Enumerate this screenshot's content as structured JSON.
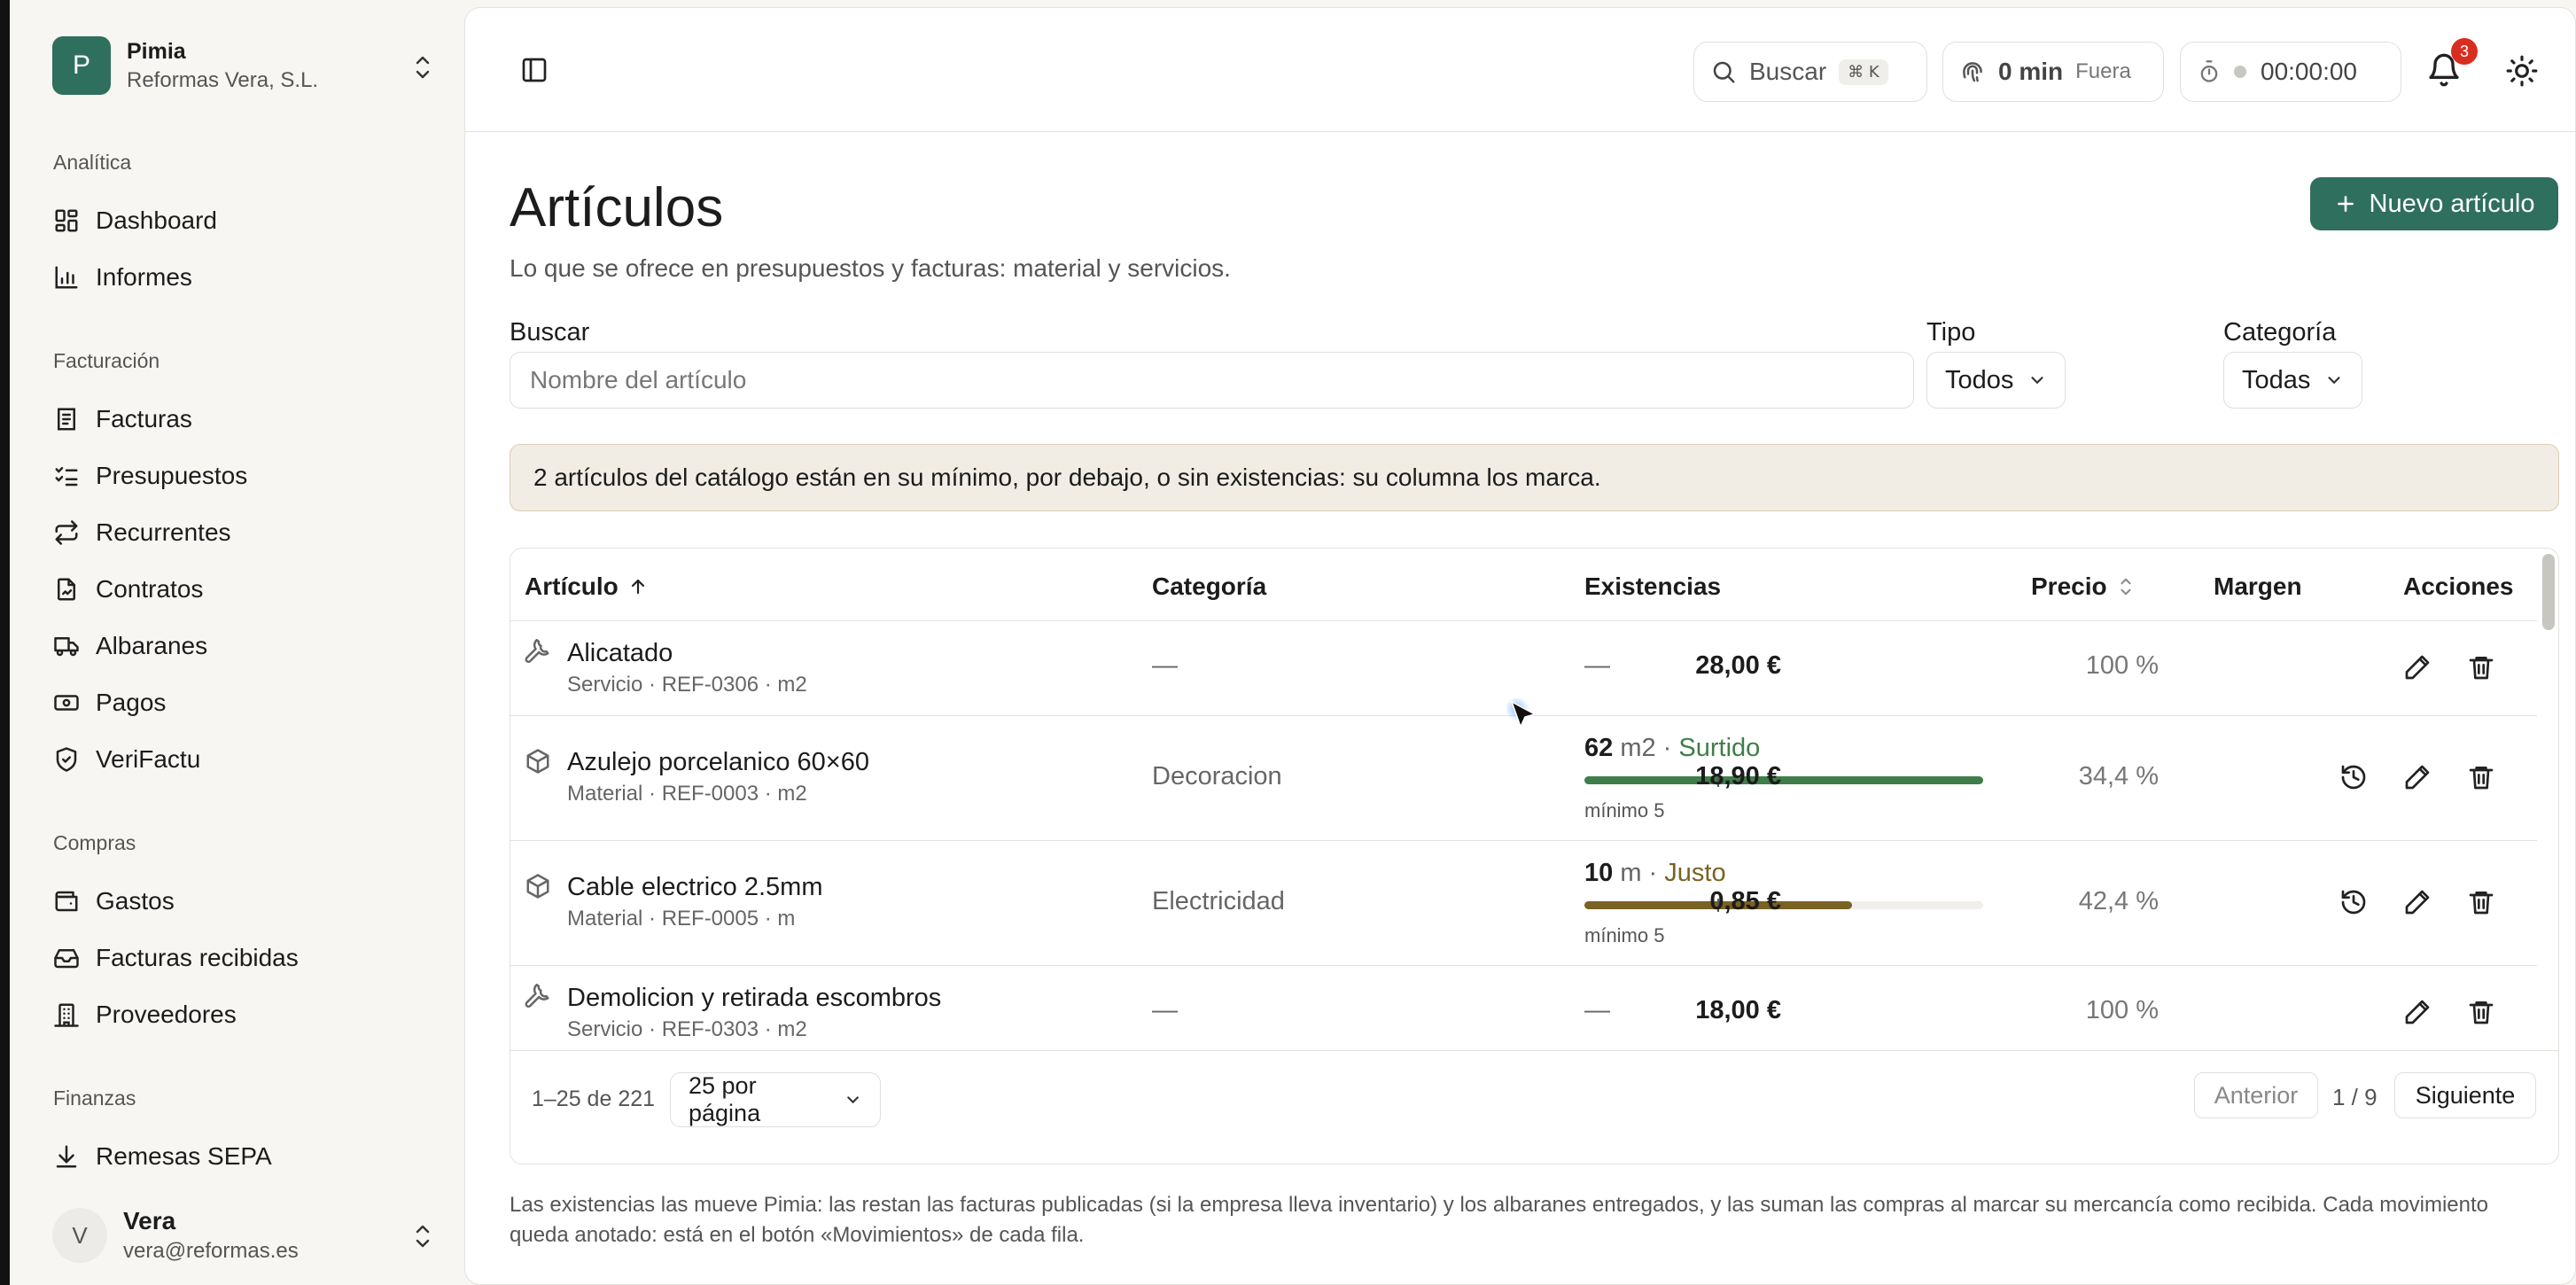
{
  "org": {
    "initial": "P",
    "name": "Pimia",
    "company": "Reformas Vera, S.L."
  },
  "nav": {
    "analitica": {
      "title": "Analítica",
      "items": [
        "Dashboard",
        "Informes"
      ]
    },
    "facturacion": {
      "title": "Facturación",
      "items": [
        "Facturas",
        "Presupuestos",
        "Recurrentes",
        "Contratos",
        "Albaranes",
        "Pagos",
        "VeriFactu"
      ]
    },
    "compras": {
      "title": "Compras",
      "items": [
        "Gastos",
        "Facturas recibidas",
        "Proveedores"
      ]
    },
    "finanzas": {
      "title": "Finanzas",
      "items": [
        "Remesas SEPA"
      ]
    }
  },
  "user": {
    "initial": "V",
    "name": "Vera",
    "email": "vera@reformas.es"
  },
  "topbar": {
    "search_label": "Buscar",
    "search_kbd": "⌘ K",
    "time_value": "0 min",
    "time_status": "Fuera",
    "timer": "00:00:00",
    "notifications": "3"
  },
  "page": {
    "title": "Artículos",
    "subtitle": "Lo que se ofrece en presupuestos y facturas: material y servicios.",
    "new_button": "Nuevo artículo"
  },
  "filters": {
    "search_label": "Buscar",
    "search_placeholder": "Nombre del artículo",
    "type_label": "Tipo",
    "type_value": "Todos",
    "category_label": "Categoría",
    "category_value": "Todas"
  },
  "alert": "2 artículos del catálogo están en su mínimo, por debajo, o sin existencias: su columna los marca.",
  "table": {
    "headers": {
      "article": "Artículo",
      "category": "Categoría",
      "stock": "Existencias",
      "price": "Precio",
      "margin": "Margen",
      "actions": "Acciones"
    },
    "rows": [
      {
        "icon": "wrench-icon",
        "name": "Alicatado",
        "meta": "Servicio · REF-0306 · m2",
        "category": "—",
        "stock_text": "—",
        "price": "28,00 €",
        "margin": "100 %"
      },
      {
        "icon": "box-icon",
        "name": "Azulejo porcelanico 60×60",
        "meta": "Material · REF-0003 · m2",
        "category": "Decoracion",
        "stock_qty": "62",
        "stock_unit": " m2 · ",
        "stock_status": "Surtido",
        "stock_min": "mínimo 5",
        "stock_level": 1.0,
        "status_color": "#3f7d4a",
        "price": "18,90 €",
        "margin": "34,4 %"
      },
      {
        "icon": "box-icon",
        "name": "Cable electrico 2.5mm",
        "meta": "Material · REF-0005 · m",
        "category": "Electricidad",
        "stock_qty": "10",
        "stock_unit": " m · ",
        "stock_status": "Justo",
        "stock_min": "mínimo 5",
        "stock_level": 0.67,
        "status_color": "#7a6224",
        "price": "0,85 €",
        "margin": "42,4 %"
      },
      {
        "icon": "wrench-icon",
        "name": "Demolicion y retirada escombros",
        "meta": "Servicio · REF-0303 · m2",
        "category": "—",
        "stock_text": "—",
        "price": "18,00 €",
        "margin": "100 %"
      }
    ]
  },
  "pagination": {
    "range": "1–25 de 221",
    "per_page": "25 por página",
    "prev": "Anterior",
    "count": "1 / 9",
    "next": "Siguiente"
  },
  "footnote": "Las existencias las mueve Pimia: las restan las facturas publicadas (si la empresa lleva inventario) y los albaranes entregados, y las suman las compras al marcar su mercancía como recibida. Cada movimiento queda anotado: está en el botón «Movimientos» de cada fila."
}
